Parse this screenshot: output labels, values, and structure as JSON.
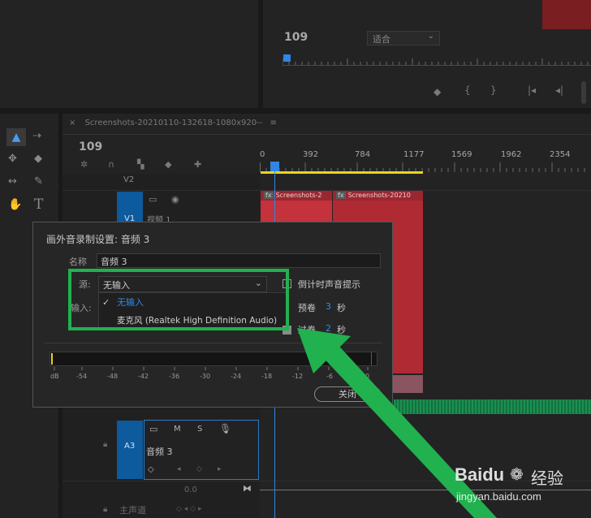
{
  "program_monitor": {
    "timecode": "109",
    "zoom_select": "适合"
  },
  "timeline": {
    "tab_title": "Screenshots-20210110-132618-1080x920--",
    "timecode": "109",
    "ruler_labels": [
      "0",
      "392",
      "784",
      "1177",
      "1569",
      "1962",
      "2354"
    ],
    "track_v2": "V2",
    "track_v1": "V1",
    "video_label_partial": "视频 1",
    "clip1_title": "Screenshots-2",
    "clip2_title": "Screenshots-20210",
    "track_a3": "A3",
    "audio_track_name": "音频 3",
    "a3_buttons": {
      "m": "M",
      "s": "S"
    },
    "master_label": "主声道",
    "master_value": "0.0"
  },
  "dialog": {
    "title": "画外音录制设置: 音频 3",
    "name_label": "名称",
    "name_value": "音频 3",
    "source_label": "源:",
    "source_value": "无输入",
    "input_label": "输入:",
    "countdown_label": "倒计时声音提示",
    "preroll_label": "预卷",
    "preroll_value": "3",
    "postroll_label": "过卷",
    "postroll_value": "2",
    "seconds_unit": "秒",
    "dropdown_options": [
      {
        "label": "无输入",
        "selected": true
      },
      {
        "label": "麦克风 (Realtek High Definition Audio)",
        "selected": false
      }
    ],
    "meter_labels": [
      "dB",
      "-54",
      "-48",
      "-42",
      "-36",
      "-30",
      "-24",
      "-18",
      "-12",
      "-6",
      "0"
    ],
    "close_button": "关闭"
  },
  "colors": {
    "accent_blue": "#2d8ceb",
    "highlight_green": "#21b14f",
    "clip_red": "#c4323c",
    "playhead_blue": "#2f86e6",
    "work_area_yellow": "#e8d51c"
  },
  "watermark": {
    "brand": "Baidu",
    "brand_cn": "经验",
    "url": "jingyan.baidu.com"
  }
}
